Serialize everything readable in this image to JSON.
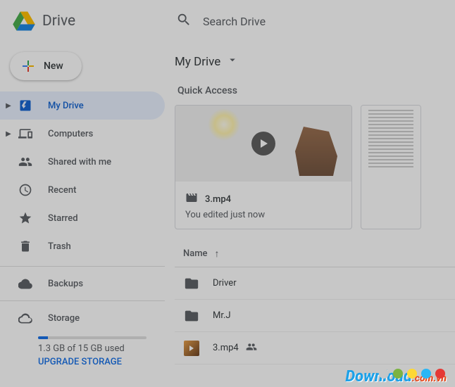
{
  "header": {
    "app_title": "Drive",
    "search_placeholder": "Search Drive"
  },
  "new_button": {
    "label": "New"
  },
  "sidebar": {
    "items": [
      {
        "label": "My Drive",
        "has_caret": true,
        "active": true,
        "icon": "drive-blue"
      },
      {
        "label": "Computers",
        "has_caret": true,
        "icon": "devices"
      },
      {
        "label": "Shared with me",
        "icon": "people"
      },
      {
        "label": "Recent",
        "icon": "clock"
      },
      {
        "label": "Starred",
        "icon": "star"
      },
      {
        "label": "Trash",
        "icon": "trash"
      }
    ],
    "backups": {
      "label": "Backups"
    },
    "storage": {
      "label": "Storage",
      "used_text": "1.3 GB of 15 GB used",
      "upgrade_label": "UPGRADE STORAGE",
      "percent": 9
    }
  },
  "content": {
    "path": "My Drive",
    "quick_access_title": "Quick Access",
    "cards": [
      {
        "filename": "3.mp4",
        "subtitle": "You edited just now",
        "type": "video"
      },
      {
        "type": "document"
      }
    ],
    "list": {
      "sort_column": "Name",
      "rows": [
        {
          "name": "Driver",
          "type": "folder"
        },
        {
          "name": "Mr.J",
          "type": "folder"
        },
        {
          "name": "3.mp4",
          "type": "video",
          "shared": true
        }
      ]
    }
  },
  "watermark": {
    "text": "Download",
    "suffix": ".com.vn"
  },
  "dot_colors": [
    "#c7c7c7",
    "#7cb342",
    "#fdd835",
    "#29b6f6",
    "#e53935"
  ]
}
